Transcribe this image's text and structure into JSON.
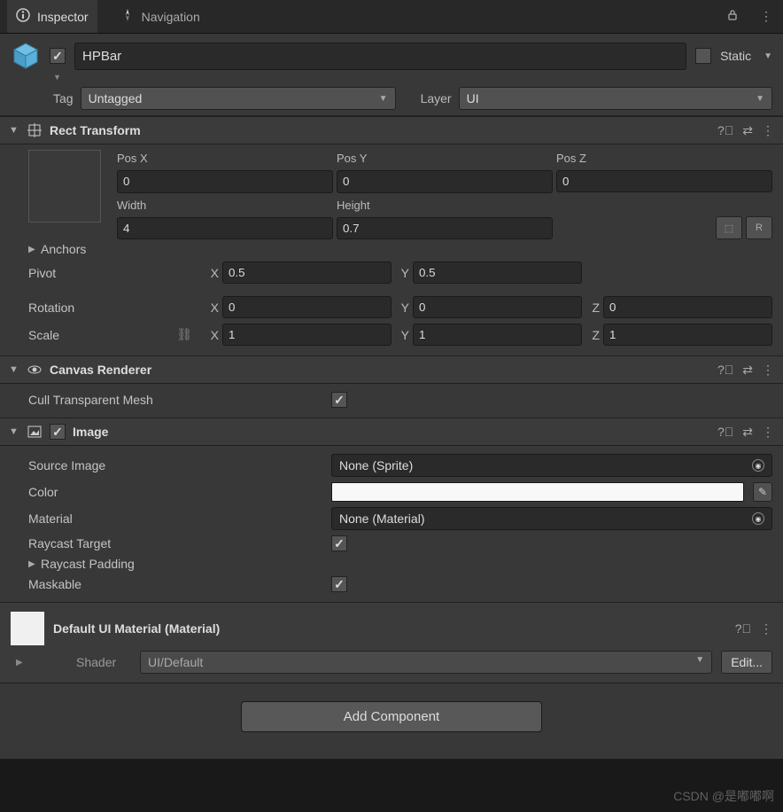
{
  "tabs": {
    "inspector": "Inspector",
    "navigation": "Navigation"
  },
  "header": {
    "name": "HPBar",
    "static_label": "Static",
    "tag_label": "Tag",
    "tag_value": "Untagged",
    "layer_label": "Layer",
    "layer_value": "UI"
  },
  "rect_transform": {
    "title": "Rect Transform",
    "posx_label": "Pos X",
    "posx": "0",
    "posy_label": "Pos Y",
    "posy": "0",
    "posz_label": "Pos Z",
    "posz": "0",
    "width_label": "Width",
    "width": "4",
    "height_label": "Height",
    "height": "0.7",
    "anchors_label": "Anchors",
    "pivot_label": "Pivot",
    "pivot_x": "0.5",
    "pivot_y": "0.5",
    "rotation_label": "Rotation",
    "rot_x": "0",
    "rot_y": "0",
    "rot_z": "0",
    "scale_label": "Scale",
    "scale_x": "1",
    "scale_y": "1",
    "scale_z": "1",
    "x": "X",
    "y": "Y",
    "z": "Z",
    "blueprint_icon": "⬚",
    "raw_icon": "R"
  },
  "canvas_renderer": {
    "title": "Canvas Renderer",
    "cull_label": "Cull Transparent Mesh"
  },
  "image": {
    "title": "Image",
    "source_label": "Source Image",
    "source_value": "None (Sprite)",
    "color_label": "Color",
    "color_value": "#f8f8f8",
    "material_label": "Material",
    "material_value": "None (Material)",
    "raycast_label": "Raycast Target",
    "raycast_padding_label": "Raycast Padding",
    "maskable_label": "Maskable"
  },
  "material": {
    "title": "Default UI Material (Material)",
    "shader_label": "Shader",
    "shader_value": "UI/Default",
    "edit": "Edit..."
  },
  "footer": {
    "add_component": "Add Component"
  },
  "watermark": "CSDN @是嘟嘟啊"
}
